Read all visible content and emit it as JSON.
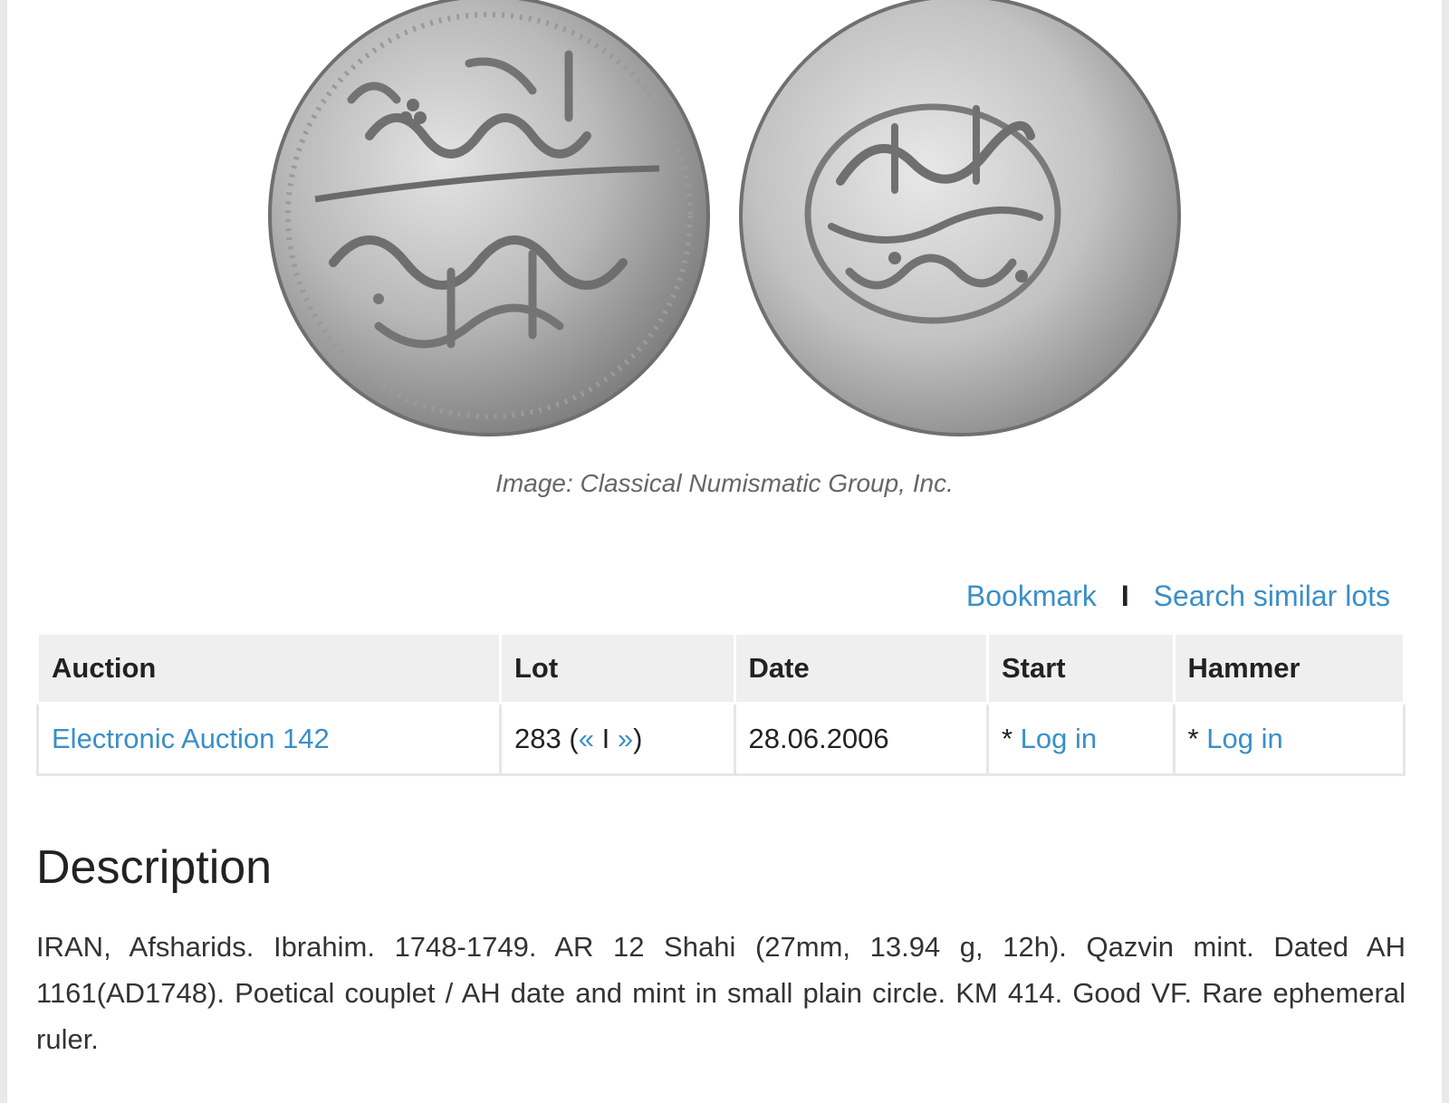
{
  "image": {
    "caption": "Image: Classical Numismatic Group, Inc."
  },
  "actions": {
    "bookmark": "Bookmark",
    "separator": "I",
    "search_similar": "Search similar lots"
  },
  "table": {
    "headers": [
      "Auction",
      "Lot",
      "Date",
      "Start",
      "Hammer"
    ],
    "row": {
      "auction": "Electronic Auction 142",
      "lot_number": "283",
      "lot_open": "(",
      "lot_prev": "«",
      "lot_sep": "I",
      "lot_next": "»",
      "lot_close": ")",
      "date": "28.06.2006",
      "start_prefix": "*",
      "start_link": "Log in",
      "hammer_prefix": "*",
      "hammer_link": "Log in"
    }
  },
  "description": {
    "heading": "Description",
    "text": "IRAN, Afsharids. Ibrahim. 1748-1749. AR 12 Shahi (27mm, 13.94 g, 12h). Qazvin mint. Dated AH 1161(AD1748). Poetical couplet / AH date and mint in small plain circle. KM 414. Good VF. Rare ephemeral ruler."
  }
}
